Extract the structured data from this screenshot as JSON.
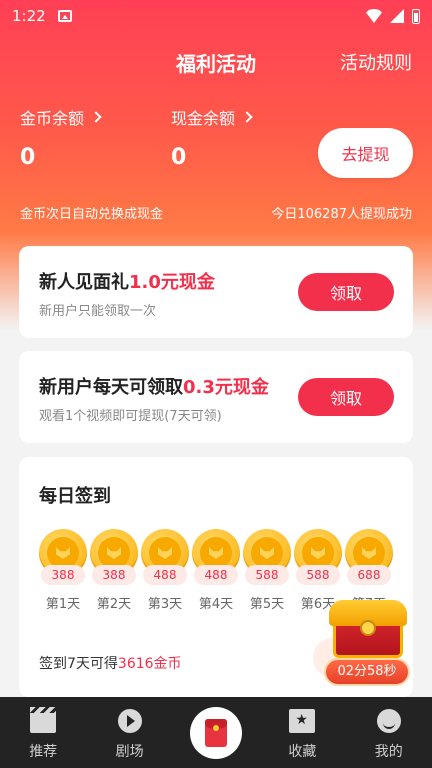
{
  "status_bar": {
    "time": "1:22"
  },
  "header": {
    "title": "福利活动",
    "rules": "活动规则"
  },
  "balances": {
    "coins_label": "金币余额",
    "coins_value": "0",
    "cash_label": "现金余额",
    "cash_value": "0",
    "withdraw_button": "去提现",
    "hint_left": "金币次日自动兑换成现金",
    "hint_right": "今日106287人提现成功"
  },
  "cards": {
    "newbie": {
      "title_prefix": "新人见面礼",
      "title_accent": "1.0元现金",
      "subtitle": "新用户只能领取一次",
      "button": "领取"
    },
    "daily": {
      "title_prefix": "新用户每天可领取",
      "title_accent": "0.3元现金",
      "subtitle": "观看1个视频即可提现(7天可领)",
      "button": "领取"
    }
  },
  "checkin": {
    "title": "每日签到",
    "days": [
      {
        "amount": "388",
        "label": "第1天"
      },
      {
        "amount": "388",
        "label": "第2天"
      },
      {
        "amount": "488",
        "label": "第3天"
      },
      {
        "amount": "488",
        "label": "第4天"
      },
      {
        "amount": "588",
        "label": "第5天"
      },
      {
        "amount": "588",
        "label": "第6天"
      },
      {
        "amount": "688",
        "label": "第7天"
      }
    ],
    "summary_prefix": "签到7天可得",
    "summary_accent": "3616金币"
  },
  "treasure": {
    "timer": "02分58秒"
  },
  "bottom_nav": {
    "items": [
      {
        "label": "推荐",
        "icon": "clapperboard-icon"
      },
      {
        "label": "剧场",
        "icon": "play-icon"
      },
      {
        "label": "",
        "icon": "red-envelope-icon"
      },
      {
        "label": "收藏",
        "icon": "favorite-icon"
      },
      {
        "label": "我的",
        "icon": "profile-icon"
      }
    ]
  },
  "colors": {
    "accent": "#f3304b",
    "nav_bg": "#232323"
  }
}
